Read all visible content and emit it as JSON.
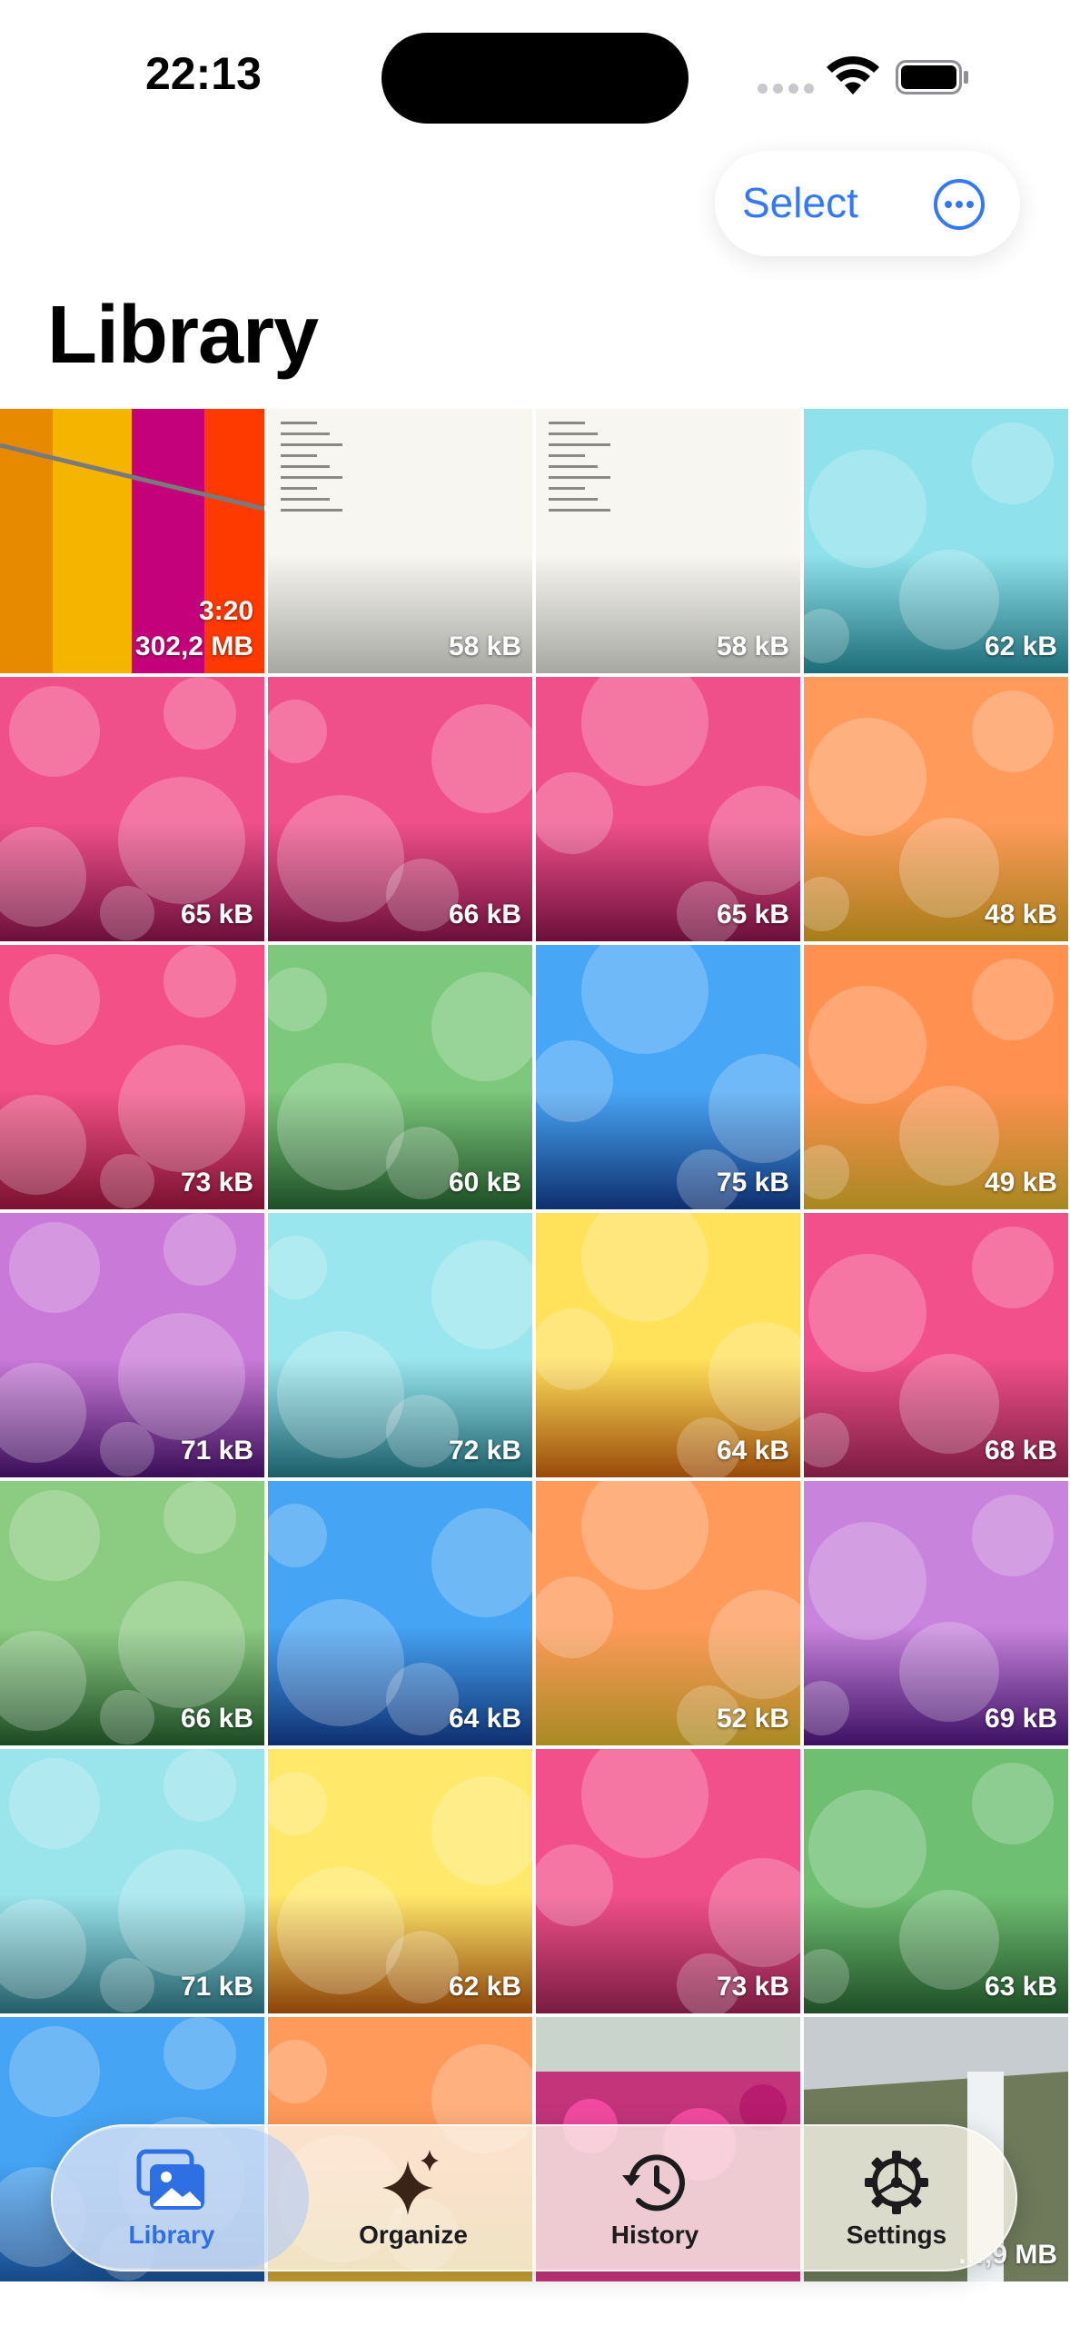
{
  "status_bar": {
    "time": "22:13"
  },
  "toolbar": {
    "select_label": "Select",
    "more_icon": "ellipsis-circle-icon"
  },
  "page": {
    "title": "Library"
  },
  "grid": {
    "items": [
      {
        "label": "302,2 MB",
        "duration": "3:20",
        "kind": "video",
        "colors": [
          "#ff8a00",
          "#e60000"
        ]
      },
      {
        "label": "58 kB",
        "kind": "receipt",
        "colors": [
          "#f7f6f1",
          "#a8a8a3"
        ]
      },
      {
        "label": "58 kB",
        "kind": "receipt",
        "colors": [
          "#f7f6f1",
          "#a8a8a3"
        ]
      },
      {
        "label": "62 kB",
        "kind": "bokeh",
        "colors": [
          "#8fe2ec",
          "#1d6d78"
        ]
      },
      {
        "label": "65 kB",
        "kind": "bokeh",
        "colors": [
          "#f0508a",
          "#6b0f3a"
        ]
      },
      {
        "label": "66 kB",
        "kind": "bokeh",
        "colors": [
          "#f0508a",
          "#6b0f3a"
        ]
      },
      {
        "label": "65 kB",
        "kind": "bokeh",
        "colors": [
          "#f0508a",
          "#6b0f3a"
        ]
      },
      {
        "label": "48 kB",
        "kind": "bokeh",
        "colors": [
          "#ff9a5a",
          "#a67d18"
        ]
      },
      {
        "label": "73 kB",
        "kind": "bokeh",
        "colors": [
          "#f25086",
          "#7a1030"
        ]
      },
      {
        "label": "60 kB",
        "kind": "bokeh",
        "colors": [
          "#7cc87c",
          "#1e4e26"
        ]
      },
      {
        "label": "75 kB",
        "kind": "bokeh",
        "colors": [
          "#48a6f6",
          "#0f2f6e"
        ]
      },
      {
        "label": "49 kB",
        "kind": "bokeh",
        "colors": [
          "#ff9050",
          "#a88820"
        ]
      },
      {
        "label": "71 kB",
        "kind": "bokeh",
        "colors": [
          "#c97ad8",
          "#3a0e58"
        ]
      },
      {
        "label": "72 kB",
        "kind": "bokeh",
        "colors": [
          "#9ae6ee",
          "#1a5e6a"
        ]
      },
      {
        "label": "64 kB",
        "kind": "bokeh",
        "colors": [
          "#ffe15a",
          "#9a4a0a"
        ]
      },
      {
        "label": "68 kB",
        "kind": "bokeh",
        "colors": [
          "#f2508a",
          "#7a1c42"
        ]
      },
      {
        "label": "66 kB",
        "kind": "bokeh",
        "colors": [
          "#8ccc82",
          "#1c4a24"
        ]
      },
      {
        "label": "64 kB",
        "kind": "bokeh",
        "colors": [
          "#46a4f4",
          "#0e2f70"
        ]
      },
      {
        "label": "52 kB",
        "kind": "bokeh",
        "colors": [
          "#ff9a5a",
          "#a88a22"
        ]
      },
      {
        "label": "69 kB",
        "kind": "bokeh",
        "colors": [
          "#c883dc",
          "#3c1064"
        ]
      },
      {
        "label": "71 kB",
        "kind": "bokeh",
        "colors": [
          "#9ae4ec",
          "#235e68"
        ]
      },
      {
        "label": "62 kB",
        "kind": "bokeh",
        "colors": [
          "#ffe86a",
          "#8c4208"
        ]
      },
      {
        "label": "73 kB",
        "kind": "bokeh",
        "colors": [
          "#f2508a",
          "#7a1c42"
        ]
      },
      {
        "label": "63 kB",
        "kind": "bokeh",
        "colors": [
          "#6fbf72",
          "#1e4e26"
        ]
      },
      {
        "label": "",
        "kind": "bokeh",
        "colors": [
          "#46a4f4",
          "#174a8a"
        ]
      },
      {
        "label": "",
        "kind": "bokeh",
        "colors": [
          "#ff9a5a",
          "#c4a030"
        ]
      },
      {
        "label": "",
        "kind": "flowers",
        "colors": [
          "#5a7a4a",
          "#e0308a"
        ]
      },
      {
        "label": "…,9 MB",
        "kind": "waterfall",
        "colors": [
          "#bfc5c8",
          "#5a6a4a"
        ]
      }
    ]
  },
  "tabbar": {
    "tabs": [
      {
        "label": "Library",
        "icon": "photo-stack-icon",
        "active": true
      },
      {
        "label": "Organize",
        "icon": "sparkles-icon",
        "active": false
      },
      {
        "label": "History",
        "icon": "clock-history-icon",
        "active": false
      },
      {
        "label": "Settings",
        "icon": "gear-icon",
        "active": false
      }
    ]
  }
}
